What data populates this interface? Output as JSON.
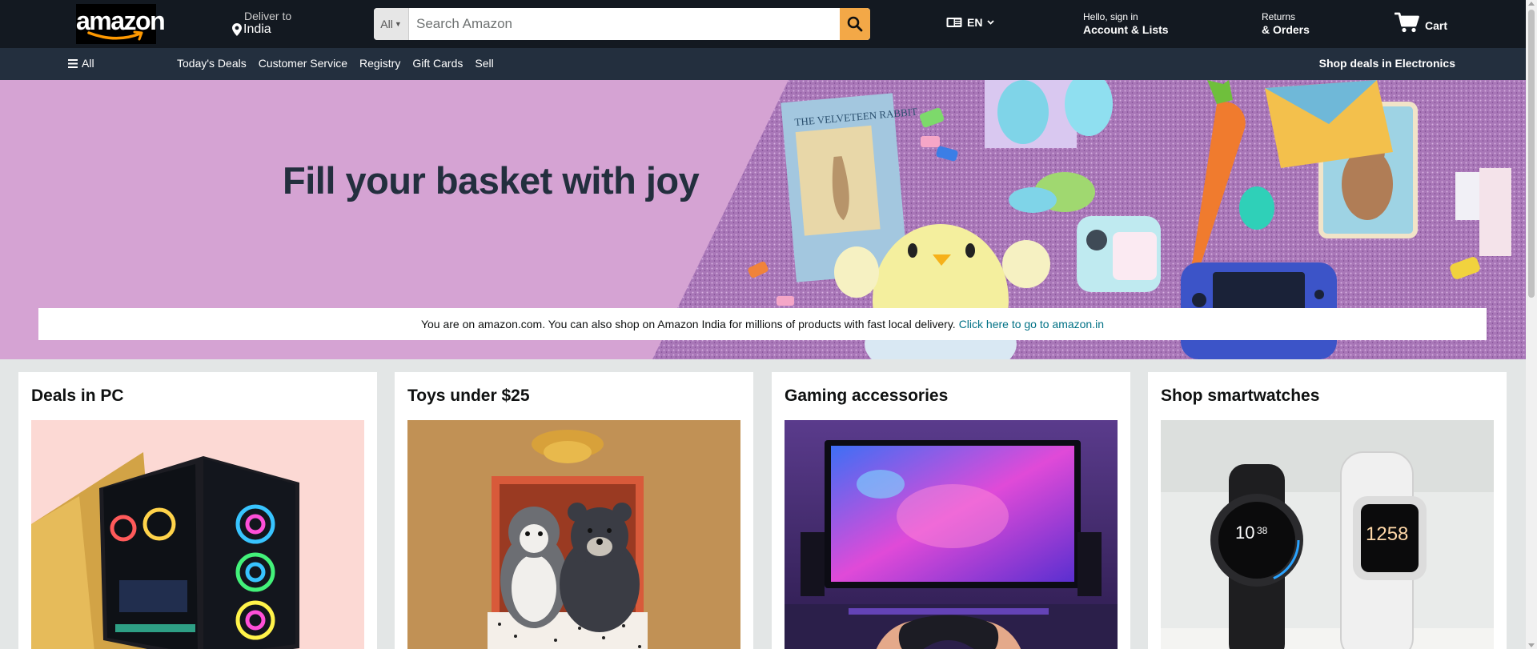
{
  "header": {
    "logo_text": "amazon",
    "deliver": {
      "label": "Deliver to",
      "location": "India"
    },
    "search": {
      "category": "All",
      "placeholder": "Search Amazon",
      "value": ""
    },
    "language": {
      "code": "EN"
    },
    "account": {
      "greeting": "Hello, sign in",
      "label": "Account & Lists"
    },
    "returns": {
      "top": "Returns",
      "bottom": "& Orders"
    },
    "cart": {
      "label": "Cart"
    }
  },
  "subnav": {
    "all_label": "All",
    "links": [
      "Today's Deals",
      "Customer Service",
      "Registry",
      "Gift Cards",
      "Sell"
    ],
    "promo": "Shop deals in Electronics"
  },
  "hero": {
    "title": "Fill your basket with joy",
    "book_title": "THE VELVETEEN RABBIT"
  },
  "notice": {
    "text": "You are on amazon.com. You can also shop on Amazon India for millions of products with fast local delivery.",
    "link": "Click here to go to amazon.in"
  },
  "cards": [
    {
      "title": "Deals in PC"
    },
    {
      "title": "Toys under $25"
    },
    {
      "title": "Gaming accessories"
    },
    {
      "title": "Shop smartwatches"
    }
  ],
  "smartwatch_display": {
    "left": "10",
    "left_sub": "38",
    "right": "1258"
  },
  "colors": {
    "header_bg": "#131921",
    "subnav_bg": "#232f3e",
    "search_button": "#f3a847",
    "hero_bg": "#d5a3d3",
    "link": "#007185",
    "page_bg": "#e3e6e6"
  }
}
